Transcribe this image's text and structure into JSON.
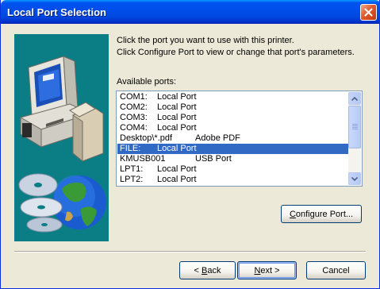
{
  "window": {
    "title": "Local Port Selection"
  },
  "instructions": {
    "line1": "Click the port you want to use with this printer.",
    "line2": "Click Configure Port to view or change that port's parameters."
  },
  "ports_label": "Available ports:",
  "ports": [
    {
      "port": "COM1:",
      "description": "Local Port",
      "printer": "",
      "selected": false
    },
    {
      "port": "COM2:",
      "description": "Local Port",
      "printer": "",
      "selected": false
    },
    {
      "port": "COM3:",
      "description": "Local Port",
      "printer": "",
      "selected": false
    },
    {
      "port": "COM4:",
      "description": "Local Port",
      "printer": "",
      "selected": false
    },
    {
      "port": "Desktop\\*.pdf",
      "description": "",
      "printer": "Adobe PDF",
      "selected": false
    },
    {
      "port": "FILE:",
      "description": "Local Port",
      "printer": "",
      "selected": true
    },
    {
      "port": "KMUSB001",
      "description": "",
      "printer": "USB Port",
      "selected": false
    },
    {
      "port": "LPT1:",
      "description": "Local Port",
      "printer": "",
      "selected": false
    },
    {
      "port": "LPT2:",
      "description": "Local Port",
      "printer": "",
      "selected": false
    }
  ],
  "buttons": {
    "configure_pre": "",
    "configure_accel": "C",
    "configure_post": "onfigure Port...",
    "back_pre": "< ",
    "back_accel": "B",
    "back_post": "ack",
    "next_pre": "",
    "next_accel": "N",
    "next_post": "ext >",
    "cancel": "Cancel"
  },
  "colors": {
    "titlebar": "#0050EE",
    "selection": "#316AC5",
    "art_background": "#0A7E84",
    "dialog_background": "#ECE9D8"
  }
}
